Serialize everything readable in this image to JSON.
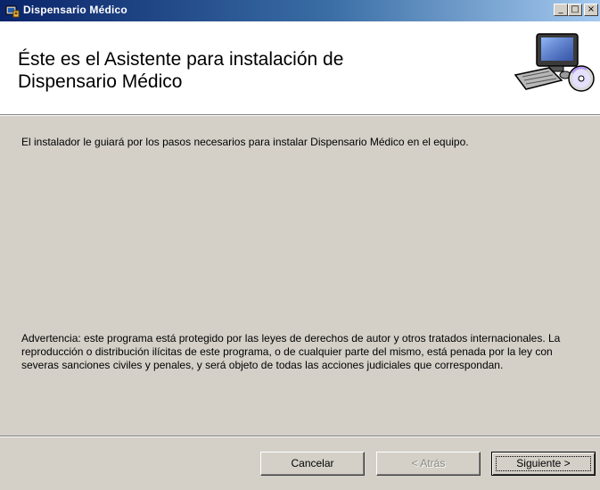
{
  "window": {
    "title": "Dispensario Médico",
    "min_glyph": "_",
    "max_glyph": "□",
    "close_glyph": "×"
  },
  "banner": {
    "heading_line1": "Éste es el Asistente para instalación de",
    "heading_line2": "Dispensario Médico"
  },
  "content": {
    "intro": "El instalador le guiará por los pasos necesarios para instalar Dispensario Médico en el equipo.",
    "warning": "Advertencia: este programa está protegido por las leyes de derechos de autor y otros tratados internacionales. La reproducción o distribución ilícitas de este programa, o de cualquier parte del mismo, está penada por la ley con severas sanciones civiles y penales, y será objeto de todas las acciones judiciales que correspondan."
  },
  "buttons": {
    "cancel": "Cancelar",
    "back": "< Atrás",
    "next": "Siguiente >"
  },
  "icons": {
    "app": "installer-app-icon",
    "banner": "computer-cd-icon"
  }
}
